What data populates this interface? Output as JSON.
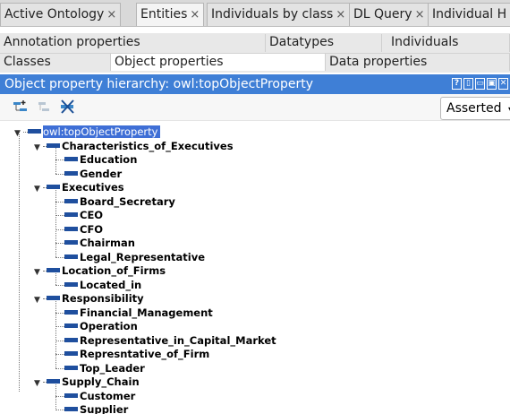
{
  "tabs": [
    {
      "label": "Active Ontology"
    },
    {
      "label": "Entities"
    },
    {
      "label": "Individuals by class"
    },
    {
      "label": "DL Query"
    },
    {
      "label": "Individual H"
    }
  ],
  "tab_close_glyph": "×",
  "subtabs_row1": [
    {
      "label": "Annotation properties"
    },
    {
      "label": "Datatypes"
    },
    {
      "label": "Individuals"
    }
  ],
  "subtabs_row2": [
    {
      "label": "Classes"
    },
    {
      "label": "Object properties"
    },
    {
      "label": "Data properties"
    }
  ],
  "view": {
    "title": "Object property hierarchy: owl:topObjectProperty",
    "buttons": [
      "?",
      "▯",
      "▭",
      "▣",
      "✕"
    ]
  },
  "toolbar": {
    "icons": [
      "add-subproperty-icon",
      "add-sibling-property-icon",
      "delete-property-icon"
    ],
    "mode_select": "Asserted"
  },
  "tree": {
    "root": "owl:topObjectProperty",
    "groups": [
      {
        "label": "Characteristics_of_Executives",
        "children": [
          "Education",
          "Gender"
        ]
      },
      {
        "label": "Executives",
        "children": [
          "Board_Secretary",
          "CEO",
          "CFO",
          "Chairman",
          "Legal_Representative"
        ]
      },
      {
        "label": "Location_of_Firms",
        "children": [
          "Located_in"
        ]
      },
      {
        "label": "Responsibility",
        "children": [
          "Financial_Management",
          "Operation",
          "Representative_in_Capital_Market",
          "Represntative_of_Firm",
          "Top_Leader"
        ]
      },
      {
        "label": "Supply_Chain",
        "children": [
          "Customer",
          "Supplier"
        ]
      }
    ]
  },
  "colors": {
    "accent": "#3f7fd6",
    "property_icon": "#1f4f9e"
  }
}
